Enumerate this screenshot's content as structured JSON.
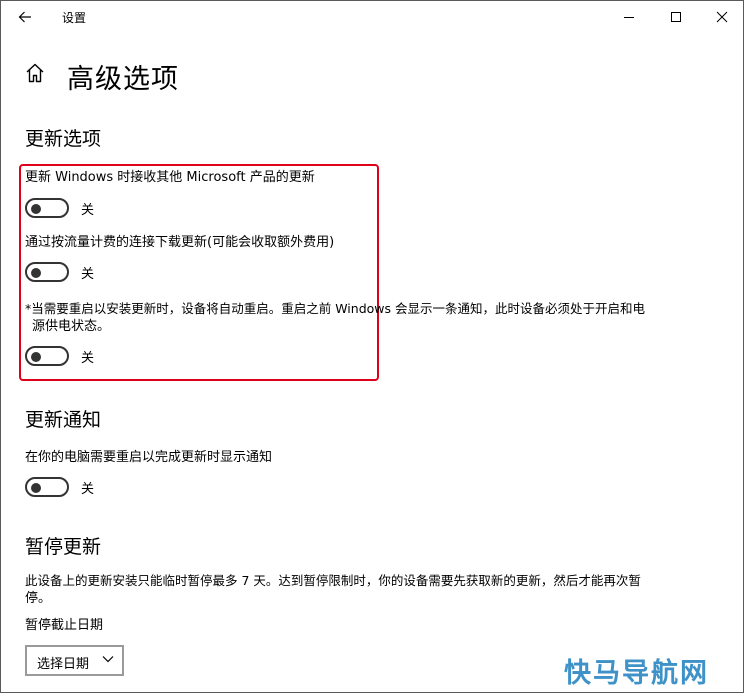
{
  "window": {
    "title": "设置"
  },
  "page": {
    "title": "高级选项"
  },
  "update_options": {
    "heading": "更新选项",
    "items": [
      {
        "label": "更新 Windows 时接收其他 Microsoft 产品的更新",
        "state": "关"
      },
      {
        "label": "通过按流量计费的连接下载更新(可能会收取额外费用)",
        "state": "关"
      },
      {
        "label_line1": "*当需要重启以安装更新时，设备将自动重启。重启之前 Windows 会显示一条通知，此时设备必须处于开启和电",
        "label_line2": "源供电状态。",
        "state": "关"
      }
    ]
  },
  "update_notifications": {
    "heading": "更新通知",
    "label": "在你的电脑需要重启以完成更新时显示通知",
    "state": "关"
  },
  "pause_updates": {
    "heading": "暂停更新",
    "desc_line1": "此设备上的更新安装只能临时暂停最多 7 天。达到暂停限制时，你的设备需要先获取新的更新，然后才能再次暂",
    "desc_line2": "停。",
    "date_label": "暂停截止日期",
    "select_value": "选择日期"
  },
  "watermark": "快马导航网",
  "colors": {
    "highlight_border": "#e0001b",
    "watermark": "#3e92c8"
  },
  "icons": [
    "back-arrow-icon",
    "minimize-icon",
    "maximize-icon",
    "close-icon",
    "home-icon",
    "chevron-down-icon"
  ]
}
